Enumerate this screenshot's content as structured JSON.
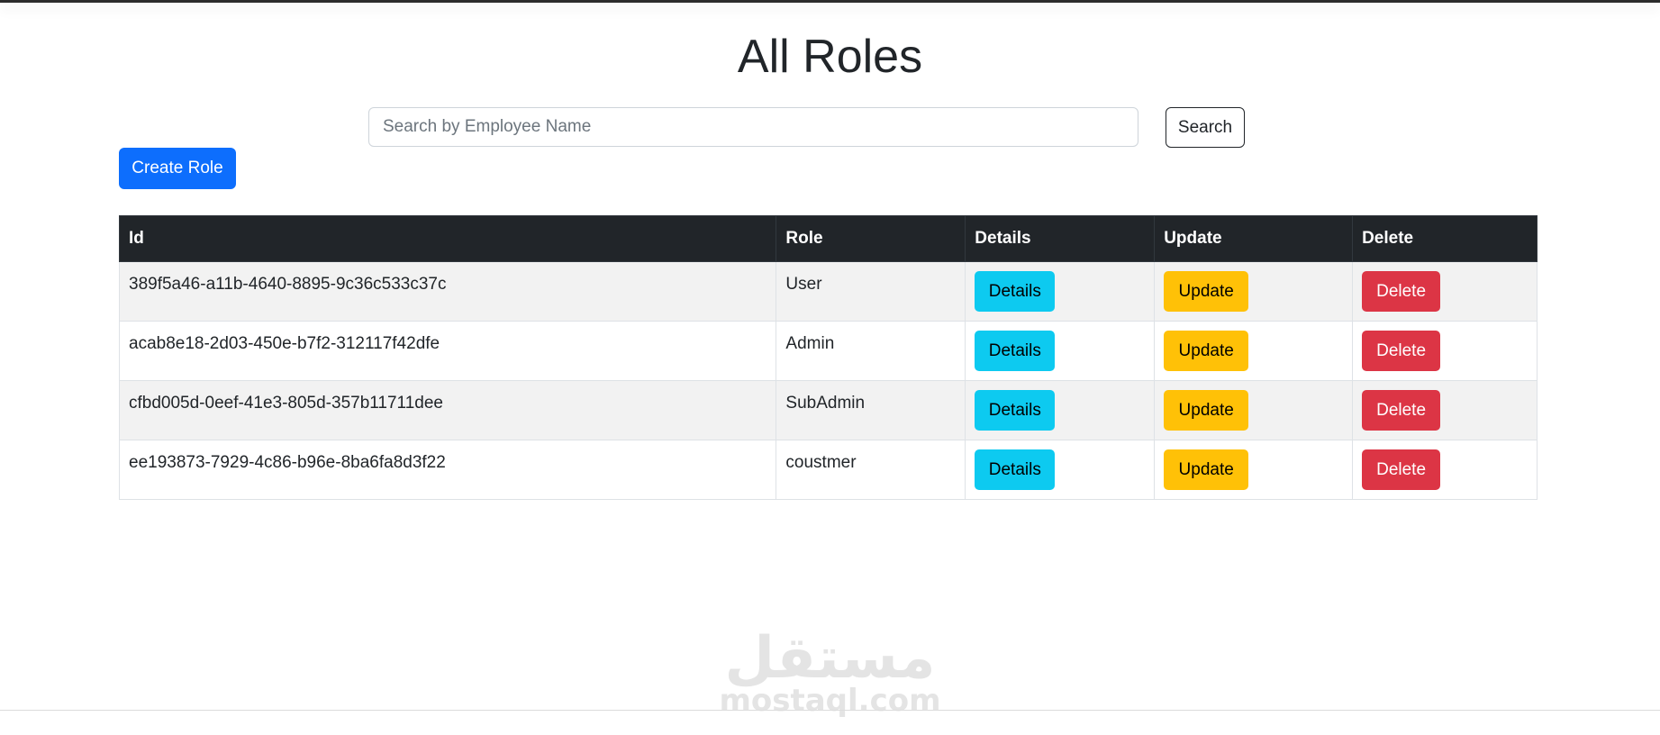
{
  "page": {
    "title": "All Roles"
  },
  "search": {
    "placeholder": "Search by Employee Name",
    "value": "",
    "button_label": "Search"
  },
  "actions": {
    "create_label": "Create Role"
  },
  "table": {
    "headers": [
      "Id",
      "Role",
      "Details",
      "Update",
      "Delete"
    ],
    "rows": [
      {
        "id": "389f5a46-a11b-4640-8895-9c36c533c37c",
        "role": "User",
        "details": "Details",
        "update": "Update",
        "delete": "Delete"
      },
      {
        "id": "acab8e18-2d03-450e-b7f2-312117f42dfe",
        "role": "Admin",
        "details": "Details",
        "update": "Update",
        "delete": "Delete"
      },
      {
        "id": "cfbd005d-0eef-41e3-805d-357b11711dee",
        "role": "SubAdmin",
        "details": "Details",
        "update": "Update",
        "delete": "Delete"
      },
      {
        "id": "ee193873-7929-4c86-b96e-8ba6fa8d3f22",
        "role": "coustmer",
        "details": "Details",
        "update": "Update",
        "delete": "Delete"
      }
    ]
  },
  "watermark": {
    "arabic": "مستقل",
    "latin": "mostaql.com"
  },
  "colors": {
    "primary": "#0d6efd",
    "info": "#0dcaf0",
    "warning": "#ffc107",
    "danger": "#dc3545",
    "table_header": "#212529"
  }
}
